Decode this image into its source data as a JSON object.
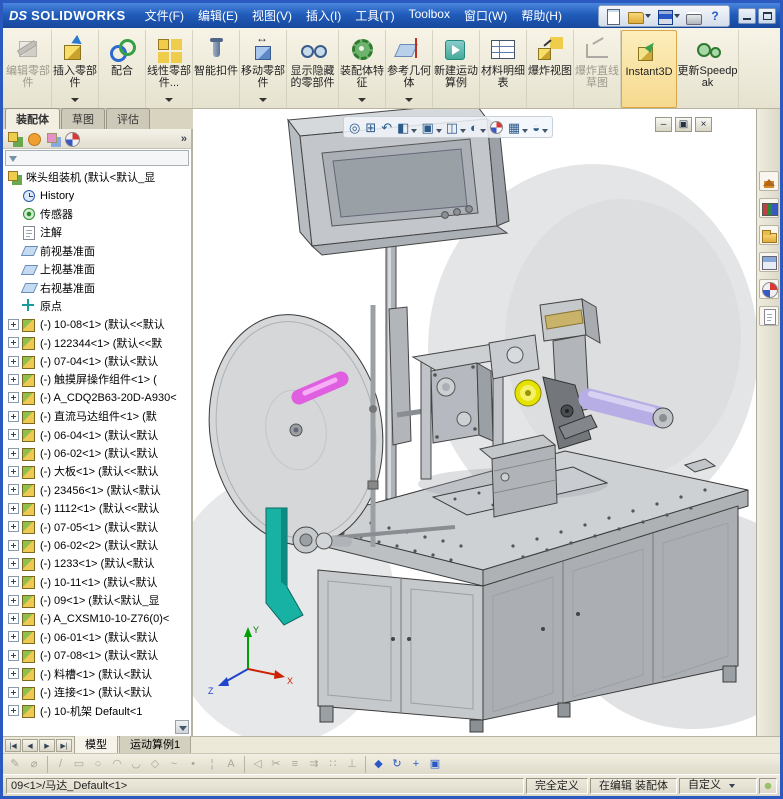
{
  "titlebar": {
    "logo_ds": "DS",
    "logo_text": "SOLIDWORKS",
    "menus": [
      {
        "name": "menu-file",
        "label": "文件(F)"
      },
      {
        "name": "menu-edit",
        "label": "编辑(E)"
      },
      {
        "name": "menu-view",
        "label": "视图(V)"
      },
      {
        "name": "menu-insert",
        "label": "插入(I)"
      },
      {
        "name": "menu-tools",
        "label": "工具(T)"
      },
      {
        "name": "menu-toolbox",
        "label": "Toolbox"
      },
      {
        "name": "menu-window",
        "label": "窗口(W)"
      },
      {
        "name": "menu-help",
        "label": "帮助(H)"
      }
    ],
    "quick_icons": [
      {
        "name": "new-document-icon",
        "cls": "qi-new",
        "glyph": ""
      },
      {
        "name": "open-icon",
        "cls": "qi-open dd",
        "glyph": ""
      },
      {
        "name": "save-icon",
        "cls": "qi-save dd",
        "glyph": ""
      },
      {
        "name": "print-icon",
        "cls": "qi-print",
        "glyph": ""
      },
      {
        "name": "help-icon",
        "cls": "qi-help",
        "glyph": "?"
      }
    ]
  },
  "commandbar": {
    "buttons": [
      {
        "name": "edit-component-button",
        "icon": "edit-component-icon",
        "icls": "ic-edit",
        "cls": "dis",
        "label": "编辑零部件"
      },
      {
        "name": "insert-components-button",
        "icon": "insert-components-icon",
        "icls": "ic-insert",
        "cls": "dd",
        "label": "插入零部件"
      },
      {
        "name": "mate-button",
        "icon": "mate-icon",
        "icls": "ic-mate",
        "cls": "",
        "label": "配合"
      },
      {
        "name": "linear-component-pattern-button",
        "icon": "linear-component-pattern-icon",
        "icls": "ic-linear",
        "cls": "dd",
        "label": "线性零部件..."
      },
      {
        "name": "smart-fasteners-button",
        "icon": "smart-fasteners-icon",
        "icls": "ic-fast",
        "cls": "",
        "label": "智能扣件"
      },
      {
        "name": "move-component-button",
        "icon": "move-component-icon",
        "icls": "ic-move",
        "cls": "dd",
        "label": "移动零部件"
      },
      {
        "name": "show-hidden-components-button",
        "icon": "show-hidden-components-icon",
        "icls": "ic-hidden",
        "cls": "w52",
        "label": "显示隐藏的零部件"
      },
      {
        "name": "assembly-features-button",
        "icon": "assembly-features-icon",
        "icls": "ic-feat",
        "cls": "dd",
        "label": "装配体特征"
      },
      {
        "name": "reference-geometry-button",
        "icon": "reference-geometry-icon",
        "icls": "ic-ref",
        "cls": "dd",
        "label": "参考几何体"
      },
      {
        "name": "new-motion-study-button",
        "icon": "new-motion-study-icon",
        "icls": "ic-motion",
        "cls": "",
        "label": "新建运动算例"
      },
      {
        "name": "bill-of-materials-button",
        "icon": "bill-of-materials-icon",
        "icls": "ic-bom",
        "cls": "",
        "label": "材料明细表"
      },
      {
        "name": "exploded-view-button",
        "icon": "exploded-view-icon",
        "icls": "ic-explode",
        "cls": "",
        "label": "爆炸视图"
      },
      {
        "name": "explode-line-sketch-button",
        "icon": "explode-line-sketch-icon",
        "icls": "ic-expline",
        "cls": "dis",
        "label": "爆炸直线草图"
      },
      {
        "name": "instant3d-button",
        "icon": "instant3d-icon",
        "icls": "ic-i3d",
        "cls": "act w56",
        "label": "Instant3D"
      },
      {
        "name": "update-speedpak-button",
        "icon": "update-speedpak-icon",
        "icls": "ic-spk",
        "cls": "w62",
        "label": "更新Speedpak"
      }
    ]
  },
  "command_tabs": [
    {
      "name": "tab-assembly",
      "label": "装配体",
      "cls": "active"
    },
    {
      "name": "tab-sketch",
      "label": "草图",
      "cls": ""
    },
    {
      "name": "tab-evaluate",
      "label": "评估",
      "cls": ""
    }
  ],
  "tree": {
    "chevron": "»",
    "header_icons": [
      {
        "name": "featuremanager-tab-icon",
        "cls": "th-tree"
      },
      {
        "name": "propertymanager-tab-icon",
        "cls": "th-prop"
      },
      {
        "name": "configurationmanager-tab-icon",
        "cls": "th-config"
      },
      {
        "name": "displaymanager-tab-icon",
        "cls": "th-ball"
      }
    ],
    "items": [
      {
        "exp": "exp-root",
        "icon": "i-assembly",
        "label": "咪头组装机 (默认<默认_显"
      },
      {
        "exp": "exp-none",
        "icon": "i-history",
        "label": "History"
      },
      {
        "exp": "exp-none",
        "icon": "i-sensor",
        "label": "传感器"
      },
      {
        "exp": "exp-none",
        "icon": "i-annot",
        "label": "注解"
      },
      {
        "exp": "exp-none",
        "icon": "i-plane",
        "label": "前视基准面"
      },
      {
        "exp": "exp-none",
        "icon": "i-plane",
        "label": "上视基准面"
      },
      {
        "exp": "exp-none",
        "icon": "i-plane",
        "label": "右视基准面"
      },
      {
        "exp": "exp-none",
        "icon": "i-origin",
        "label": "原点"
      },
      {
        "exp": "exp-plus",
        "icon": "i-part",
        "label": "(-) 10-08<1> (默认<<默认"
      },
      {
        "exp": "exp-plus",
        "icon": "i-part",
        "label": "(-) 122344<1> (默认<<默"
      },
      {
        "exp": "exp-plus",
        "icon": "i-part",
        "label": "(-) 07-04<1> (默认<默认"
      },
      {
        "exp": "exp-plus",
        "icon": "i-part",
        "label": "(-) 触摸屏操作组件<1> ("
      },
      {
        "exp": "exp-plus",
        "icon": "i-part",
        "label": "(-) A_CDQ2B63-20D-A930<"
      },
      {
        "exp": "exp-plus",
        "icon": "i-part",
        "label": "(-) 直流马达组件<1> (默"
      },
      {
        "exp": "exp-plus",
        "icon": "i-part",
        "label": "(-) 06-04<1> (默认<默认"
      },
      {
        "exp": "exp-plus",
        "icon": "i-part",
        "label": "(-) 06-02<1> (默认<默认"
      },
      {
        "exp": "exp-plus",
        "icon": "i-part",
        "label": "(-) 大板<1> (默认<<默认"
      },
      {
        "exp": "exp-plus",
        "icon": "i-part",
        "label": "(-) 23456<1> (默认<默认"
      },
      {
        "exp": "exp-plus",
        "icon": "i-part",
        "label": "(-) 1112<1> (默认<<默认"
      },
      {
        "exp": "exp-plus",
        "icon": "i-part",
        "label": "(-) 07-05<1> (默认<默认"
      },
      {
        "exp": "exp-plus",
        "icon": "i-part",
        "label": "(-) 06-02<2> (默认<默认"
      },
      {
        "exp": "exp-plus",
        "icon": "i-part",
        "label": "(-) 1233<1> (默认<默认"
      },
      {
        "exp": "exp-plus",
        "icon": "i-part",
        "label": "(-) 10-11<1> (默认<默认"
      },
      {
        "exp": "exp-plus",
        "icon": "i-part",
        "label": "(-) 09<1> (默认<默认_显"
      },
      {
        "exp": "exp-plus",
        "icon": "i-part",
        "label": "(-) A_CXSM10-10-Z76(0)<"
      },
      {
        "exp": "exp-plus",
        "icon": "i-part",
        "label": "(-) 06-01<1> (默认<默认"
      },
      {
        "exp": "exp-plus",
        "icon": "i-part",
        "label": "(-) 07-08<1> (默认<默认"
      },
      {
        "exp": "exp-plus",
        "icon": "i-part",
        "label": "(-) 料槽<1> (默认<默认"
      },
      {
        "exp": "exp-plus",
        "icon": "i-part",
        "label": "(-) 连接<1> (默认<默认"
      },
      {
        "exp": "exp-plus",
        "icon": "i-part",
        "label": "(-) 10-机架 Default<1"
      }
    ]
  },
  "viewport": {
    "hud_icons": [
      {
        "name": "zoom-fit-icon",
        "glyph": "◎",
        "cls": ""
      },
      {
        "name": "zoom-area-icon",
        "glyph": "⊞",
        "cls": ""
      },
      {
        "name": "previous-view-icon",
        "glyph": "↶",
        "cls": ""
      },
      {
        "name": "section-view-icon",
        "glyph": "◧",
        "cls": "dd"
      },
      {
        "name": "view-orientation-icon",
        "glyph": "▣",
        "cls": "dd"
      },
      {
        "name": "display-style-icon",
        "glyph": "◫",
        "cls": "dd"
      },
      {
        "name": "hide-show-items-icon",
        "glyph": "◐",
        "cls": "dd"
      },
      {
        "name": "edit-appearance-icon",
        "glyph": "",
        "cls": "ball"
      },
      {
        "name": "apply-scene-icon",
        "glyph": "▦",
        "cls": "dd"
      },
      {
        "name": "view-settings-icon",
        "glyph": "◒",
        "cls": "dd"
      }
    ],
    "child_window_buttons": [
      {
        "name": "child-minimize-button",
        "glyph": "–"
      },
      {
        "name": "child-restore-button",
        "glyph": "▣"
      },
      {
        "name": "child-close-button",
        "glyph": "×"
      }
    ],
    "triad": {
      "x": "X",
      "y": "Y",
      "z": "Z"
    },
    "model_colors": {
      "machine_gray": "#c6c9cc",
      "disc": "#d5d7d9",
      "magenta_pin": "#e05fe0",
      "teal_bracket": "#18b2a5",
      "yellow_coupling": "#e6e200",
      "lavender_cylinder": "#b6aee4"
    }
  },
  "taskpane": {
    "icons": [
      {
        "name": "resources-home-icon",
        "cls": "tp-home"
      },
      {
        "name": "design-library-icon",
        "cls": "tp-books"
      },
      {
        "name": "file-explorer-icon",
        "cls": "tp-folder"
      },
      {
        "name": "view-palette-icon",
        "cls": "tp-palette"
      },
      {
        "name": "appearances-scenes-icon",
        "cls": "tp-ball"
      },
      {
        "name": "custom-properties-icon",
        "cls": "tp-doc"
      }
    ]
  },
  "bottom": {
    "tab_nav": [
      {
        "name": "first-tab-button",
        "glyph": "|◀"
      },
      {
        "name": "prev-tab-button",
        "glyph": "◀"
      },
      {
        "name": "next-tab-button",
        "glyph": "▶"
      },
      {
        "name": "last-tab-button",
        "glyph": "▶|"
      }
    ],
    "doc_tabs": [
      {
        "name": "tab-model",
        "label": "模型",
        "cls": "active"
      },
      {
        "name": "tab-motion-study-1",
        "label": "运动算例1",
        "cls": ""
      }
    ],
    "sketch_icons": [
      {
        "name": "sketch-icon",
        "glyph": "✎",
        "cls": "dis"
      },
      {
        "name": "smart-dimension-icon",
        "glyph": "⌀",
        "cls": "dis"
      },
      {
        "name": "line-icon",
        "glyph": "/",
        "cls": "dis sep"
      },
      {
        "name": "rectangle-icon",
        "glyph": "▭",
        "cls": "dis"
      },
      {
        "name": "circle-icon",
        "glyph": "○",
        "cls": "dis"
      },
      {
        "name": "arc-icon",
        "glyph": "◠",
        "cls": "dis"
      },
      {
        "name": "tangent-arc-icon",
        "glyph": "◡",
        "cls": "dis"
      },
      {
        "name": "polygon-icon",
        "glyph": "◇",
        "cls": "dis"
      },
      {
        "name": "spline-icon",
        "glyph": "~",
        "cls": "dis"
      },
      {
        "name": "point-icon",
        "glyph": "•",
        "cls": "dis"
      },
      {
        "name": "centerline-icon",
        "glyph": "¦",
        "cls": "dis"
      },
      {
        "name": "text-icon",
        "glyph": "A",
        "cls": "dis"
      },
      {
        "name": "mirror-entities-icon",
        "glyph": "◁",
        "cls": "dis sep"
      },
      {
        "name": "trim-entities-icon",
        "glyph": "✂",
        "cls": "dis"
      },
      {
        "name": "offset-entities-icon",
        "glyph": "≡",
        "cls": "dis"
      },
      {
        "name": "convert-entities-icon",
        "glyph": "⇉",
        "cls": "dis"
      },
      {
        "name": "linear-sketch-pattern-icon",
        "glyph": "∷",
        "cls": "dis"
      },
      {
        "name": "add-relation-icon",
        "glyph": "⊥",
        "cls": "dis"
      },
      {
        "name": "isometric-view-icon",
        "glyph": "◆",
        "cls": "blue sep"
      },
      {
        "name": "rotate-view-icon",
        "glyph": "↻",
        "cls": "blue"
      },
      {
        "name": "pan-view-icon",
        "glyph": "+",
        "cls": "blue"
      },
      {
        "name": "window-zoom-icon",
        "glyph": "▣",
        "cls": "blue"
      }
    ]
  },
  "statusbar": {
    "left": "09<1>/马达_Default<1>",
    "define_state": "完全定义",
    "edit_state": "在编辑 装配体",
    "custom": "自定义"
  }
}
